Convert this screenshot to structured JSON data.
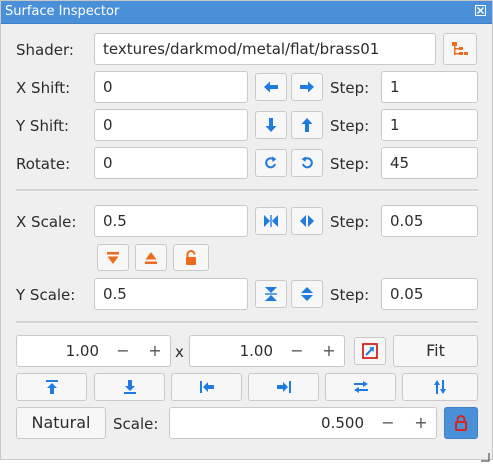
{
  "window": {
    "title": "Surface Inspector"
  },
  "colors": {
    "accent": "#4a90d9",
    "blue_icon": "#1e7be0",
    "orange_icon": "#ec6b1d",
    "red_icon": "#d9231d"
  },
  "shader": {
    "label": "Shader:",
    "value": "textures/darkmod/metal/flat/brass01",
    "browse_icon": "folder-tree-icon"
  },
  "x_shift": {
    "label": "X Shift:",
    "value": "0",
    "step_label": "Step:",
    "step": "1",
    "icons": [
      "arrow-left-icon",
      "arrow-right-icon"
    ]
  },
  "y_shift": {
    "label": "Y Shift:",
    "value": "0",
    "step_label": "Step:",
    "step": "1",
    "icons": [
      "arrow-down-icon",
      "arrow-up-icon"
    ]
  },
  "rotate": {
    "label": "Rotate:",
    "value": "0",
    "step_label": "Step:",
    "step": "45",
    "icons": [
      "rotate-clockwise-icon",
      "rotate-counterclockwise-icon"
    ]
  },
  "x_scale": {
    "label": "X Scale:",
    "value": "0.5",
    "step_label": "Step:",
    "step": "0.05",
    "icons": [
      "scale-x-shrink-icon",
      "scale-x-grow-icon"
    ]
  },
  "scale_extra_icons": [
    "flip-down-icon",
    "flip-up-icon",
    "unlock-icon"
  ],
  "y_scale": {
    "label": "Y Scale:",
    "value": "0.5",
    "step_label": "Step:",
    "step": "0.05",
    "icons": [
      "scale-y-shrink-icon",
      "scale-y-grow-icon"
    ]
  },
  "fit": {
    "width": "1.00",
    "height": "1.00",
    "times": "x",
    "minus": "−",
    "plus": "+",
    "fit_label": "Fit",
    "icon": "fit-texture-icon"
  },
  "align_icons": [
    "align-top-icon",
    "align-bottom-icon",
    "align-left-icon",
    "align-right-icon",
    "flip-horizontal-icon",
    "flip-vertical-icon"
  ],
  "natural": {
    "button_label": "Natural",
    "scale_label": "Scale:",
    "scale_value": "0.500",
    "minus": "−",
    "plus": "+",
    "lock_icon": "lock-icon"
  }
}
